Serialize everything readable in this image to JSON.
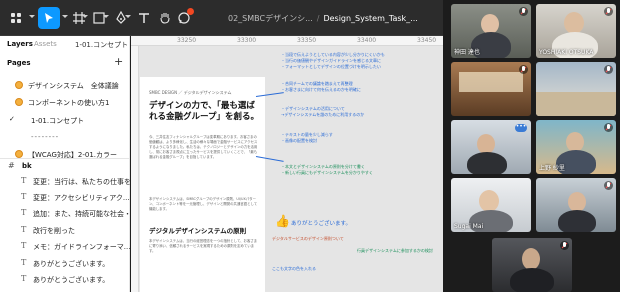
{
  "toolbar": {
    "file_name": "02_SMBCデザインシ...",
    "separator": "/",
    "page_name": "Design_System_Task_..."
  },
  "left_panel": {
    "tabs": [
      "Layers",
      "Assets",
      "1-01.コンセプト"
    ],
    "pages_header": "Pages",
    "add_label": "+",
    "pages": [
      {
        "label": "デザインシステム　全体議論",
        "emoji": true
      },
      {
        "label": "コンポーネントの使い方1",
        "emoji": true
      },
      {
        "label": "1-01.コンセプト",
        "selected": true
      },
      {
        "label": "--------"
      },
      {
        "label": "【WCAG対応】2-01.カラー",
        "emoji": true
      }
    ],
    "layer_group": "bk",
    "layers": [
      "変更：当行は、私たちの仕事を...",
      "変更：アクセシビリティアク...",
      "追加：また、持続可能な社会・...",
      "改行を削った",
      "メモ：ガイドラインフォーマ...",
      "ありがとうございます。",
      "ありがとうございます。"
    ]
  },
  "canvas": {
    "ruler_ticks": [
      "33250",
      "33300",
      "33350",
      "33400",
      "33450"
    ],
    "frame": {
      "breadcrumb": "SMBC DESIGN ／ デジタルデザインシステム",
      "headline": "デザインの力で、「最も選ばれる金融グループ」を創る。",
      "para1": "今、三井住友フィナンシャルグループは変革期にあります。お客さまの価値観は、より多様化し、生活の様々な場面で金融サービスにアクセスするようになりました。私たちは、テクノロジーとデザインの力を活用し、常にお客さま視点に立ったサービスを提供していくことで、「最も選ばれる金融グループ」を目指しています。",
      "para2": "本デザインシステムは、SMBCグループのデザイン原則、UI/UXパターン、コンポーネント等を一元管理し、デザインと開発の共通言語として機能します。",
      "section_title": "デジタルデザインシステムの原則",
      "para3": "本デザインシステムは、当行の経営理念を一つの指針として、お客さまに寄り添い、信頼されるサービスを実現するための原則を定めています。"
    },
    "notes": [
      "・当段で伝えようとしている内容が少し分かりにくいかも",
      "・当行の価値観やデザインガイドラインを感じる文章に",
      "・フォーマットとしてデザインの位置づけを明示したい",
      "・合同チームでの議論を踏まえて再整理",
      "・お客さまに向けて何を伝えるのかを明確に",
      "・デザインシステムの活用について",
      "→デザインシステムを誰のために利用するのか",
      "・テキストの量を少し減らす",
      "・画像の配置を検討",
      "・本文とデザインシステムの原則を分けて書く",
      "・新しい行員にもデザインシステムを分かりやすく"
    ],
    "thumbs_text": "ありがとうございます。",
    "note_bottom": "デジタルサービスのデザイン原則ついて",
    "note_bottom2": "ここも文字の色を入れる",
    "note_right": "行員デザインシステムに参加するかの検討"
  },
  "video": {
    "participants": [
      {
        "name": "神田 達也",
        "muted": true
      },
      {
        "name": "YOSHIAKI OTSUKA",
        "muted": true
      },
      {
        "name": "",
        "muted": true
      },
      {
        "name": "",
        "muted": true
      },
      {
        "name": "",
        "muted": false,
        "more": true
      },
      {
        "name": "上野 紗里",
        "muted": true
      },
      {
        "name": "Sugai Mai",
        "muted": false
      },
      {
        "name": "",
        "muted": true
      },
      {
        "name": "",
        "muted": true
      }
    ]
  }
}
